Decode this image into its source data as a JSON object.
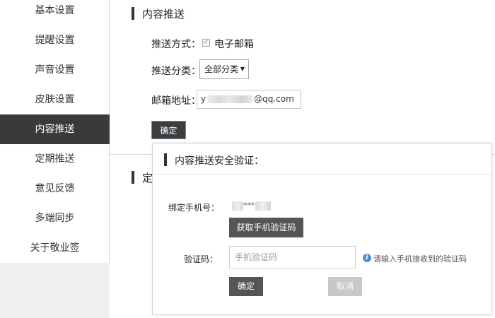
{
  "sidebar": {
    "items": [
      {
        "label": "基本设置"
      },
      {
        "label": "提醒设置"
      },
      {
        "label": "声音设置"
      },
      {
        "label": "皮肤设置"
      },
      {
        "label": "内容推送",
        "active": true
      },
      {
        "label": "定期推送"
      },
      {
        "label": "意见反馈"
      },
      {
        "label": "多端同步"
      },
      {
        "label": "关于敬业签"
      }
    ]
  },
  "content_push": {
    "title": "内容推送",
    "method_label": "推送方式：",
    "method_checked": true,
    "method_option": "电子邮箱",
    "category_label": "推送分类：",
    "category_value": "全部分类",
    "email_label": "邮箱地址：",
    "email_prefix": "y",
    "email_suffix": "@qq.com",
    "confirm_label": "确定"
  },
  "scheduled_push": {
    "title_partial": "定"
  },
  "verify_dialog": {
    "title": "内容推送安全验证：",
    "phone_label": "绑定手机号：",
    "phone_masked": "***",
    "get_code_label": "获取手机验证码",
    "code_label": "验证码：",
    "code_placeholder": "手机验证码",
    "hint": "请输入手机接收到的验证码",
    "confirm_label": "确定",
    "cancel_label": "取消"
  },
  "colors": {
    "sidebar_active_bg": "#3a3a3a",
    "primary_button": "#555555",
    "disabled_button": "#c8c8c8",
    "info_icon": "#4a90d6"
  }
}
